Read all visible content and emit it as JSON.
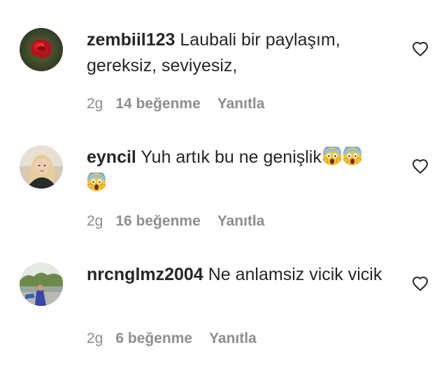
{
  "comments": [
    {
      "username": "zembiil123",
      "text": " Laubali bir paylaşım, gereksiz, seviyesiz,",
      "time": "2g",
      "likes": "14 beğenme",
      "reply": "Yanıtla",
      "avatar_icon": "rose-avatar-icon"
    },
    {
      "username": "eyncil",
      "text": " Yuh artık bu ne genişlik",
      "time": "2g",
      "likes": "16 beğenme",
      "reply": "Yanıtla",
      "avatar_icon": "blonde-woman-avatar-icon",
      "emoji": "face-screaming-in-fear-icon"
    },
    {
      "username": "nrcnglmz2004",
      "text": " Ne anlamsiz vicik vicik",
      "time": "2g",
      "likes": "6 beğenme",
      "reply": "Yanıtla",
      "avatar_icon": "outdoor-person-avatar-icon"
    }
  ],
  "colors": {
    "text": "#262626",
    "secondary": "#8e8e8e",
    "background": "#ffffff"
  }
}
